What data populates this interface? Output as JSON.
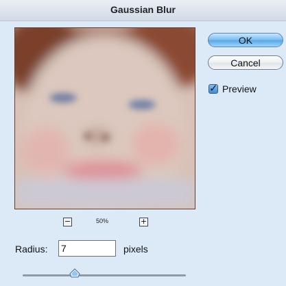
{
  "window": {
    "title": "Gaussian Blur"
  },
  "buttons": {
    "ok": "OK",
    "cancel": "Cancel"
  },
  "preview": {
    "checkbox_label": "Preview",
    "checked": true,
    "zoom_level": "50%",
    "zoom_out_symbol": "−",
    "zoom_in_symbol": "+"
  },
  "radius": {
    "label": "Radius:",
    "value": "7",
    "units": "pixels"
  },
  "slider": {
    "value": 7
  },
  "colors": {
    "dialog_bg": "#dce9f6",
    "ok_button": "#6ab3ec",
    "preview_border": "#6a3a25"
  },
  "icons": {
    "zoom_out": "zoom-out-icon",
    "zoom_in": "zoom-in-icon",
    "checkmark": "checkmark-icon",
    "slider_thumb": "slider-thumb-icon"
  }
}
